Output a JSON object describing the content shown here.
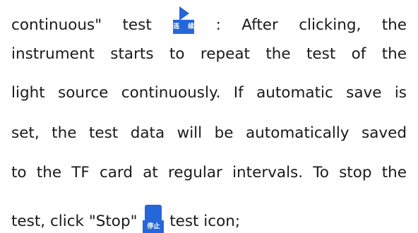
{
  "paragraph": {
    "line1_prefix": "continuous\"  test",
    "line1_suffix": ":  After  clicking,  the",
    "line2": "instrument starts to repeat the test of the",
    "line3": "light source continuously. If automatic save is",
    "line4": "set, the test data will be automatically saved",
    "line5": "to the TF card at regular intervals. To stop the",
    "line6_prefix": "test, click \"Stop\"",
    "line6_suffix": "test icon;"
  },
  "icons": {
    "continuous": {
      "name": "play-icon",
      "label": "连续",
      "color": "#2567d9"
    },
    "stop": {
      "name": "stop-icon",
      "label": "停止",
      "color": "#2567d9"
    }
  }
}
